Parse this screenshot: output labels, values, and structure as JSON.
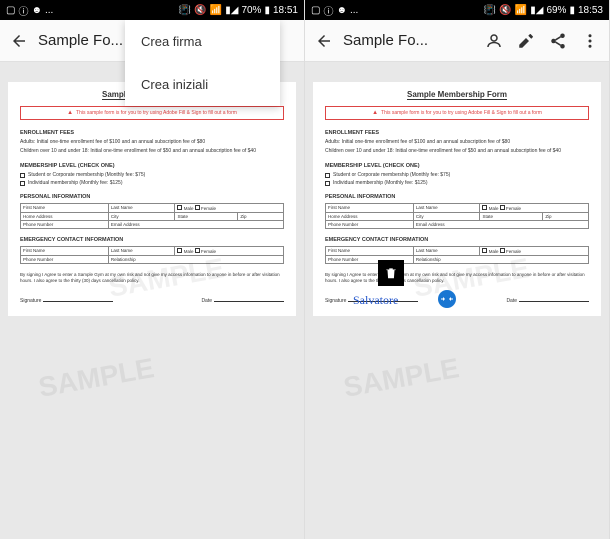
{
  "left": {
    "status": {
      "time": "18:51",
      "battery": "70%",
      "dots": "..."
    },
    "appbar": {
      "title": "Sample Fo..."
    },
    "dropdown": {
      "item1": "Crea firma",
      "item2": "Crea iniziali"
    }
  },
  "right": {
    "status": {
      "time": "18:53",
      "battery": "69%",
      "dots": "..."
    },
    "appbar": {
      "title": "Sample Fo..."
    },
    "signature": "Salvatore"
  },
  "doc": {
    "title": "Sample Membership Form",
    "banner": "This sample form is for you to try using Adobe Fill & Sign to fill out a form",
    "watermark": "SAMPLE",
    "fees": {
      "heading": "ENROLLMENT FEES",
      "line1": "Adults: Initial one-time enrollment fee of $100 and an annual subscription fee of $80",
      "line2": "Children over 10 and under 18: Initial one-time enrollment fee of $50 and an annual subscription fee of $40"
    },
    "level": {
      "heading": "MEMBERSHIP LEVEL (CHECK ONE)",
      "opt1": "Student or Corporate membership (Monthly fee: $75)",
      "opt2": "Individual membership (Monthly fee: $125)"
    },
    "personal": {
      "heading": "PERSONAL INFORMATION",
      "first": "First Name",
      "last": "Last Name",
      "male": "Male",
      "female": "Female",
      "home": "Home Address",
      "city": "City",
      "state": "State",
      "zip": "Zip",
      "phone": "Phone Number",
      "email": "Email Address"
    },
    "emergency": {
      "heading": "EMERGENCY CONTACT INFORMATION",
      "first": "First Name",
      "last": "Last Name",
      "male": "Male",
      "female": "Female",
      "phone": "Phone Number",
      "relationship": "Relationship"
    },
    "disclaimer": "By signing I Agree to enter a Sample Gym at my own risk and not give my access information to anyone in before or after visitation hours. I also agree to the thirty (30) days cancellation policy.",
    "sig_label": "Signature",
    "date_label": "Date"
  }
}
